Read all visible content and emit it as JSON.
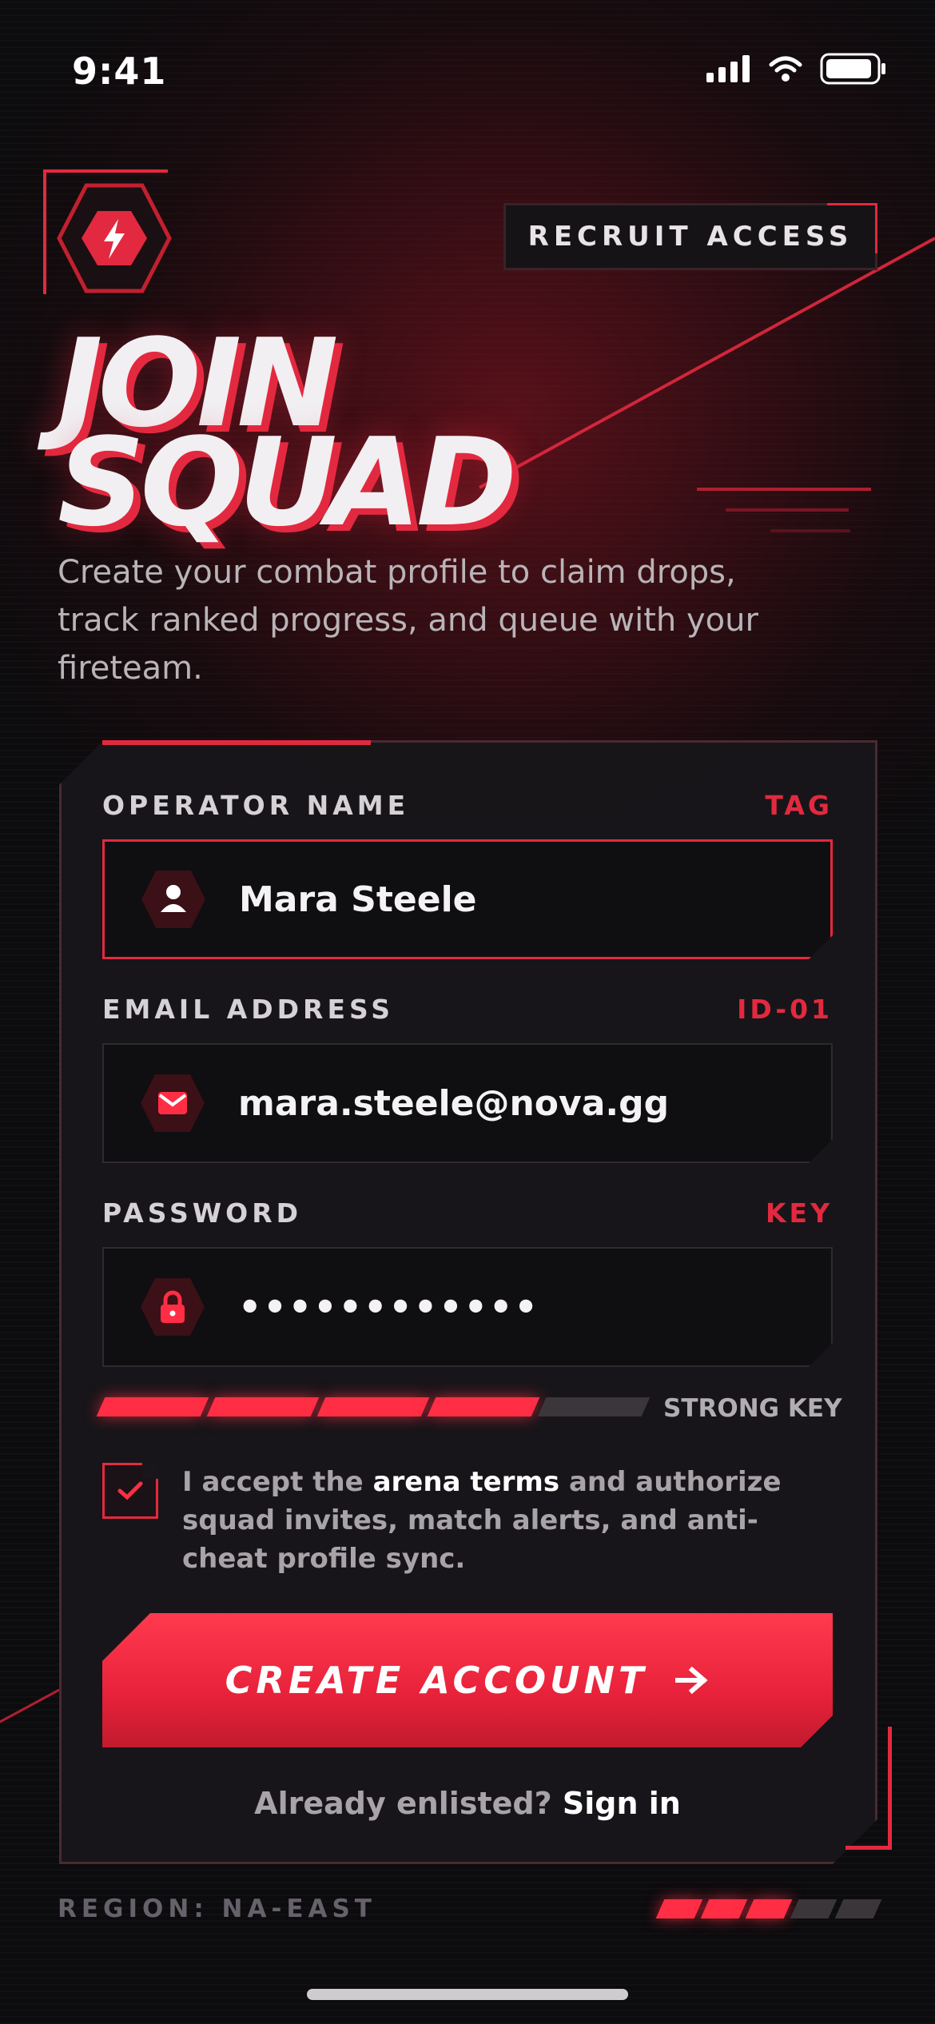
{
  "status_bar": {
    "time": "9:41",
    "icons": [
      "cellular-signal-icon",
      "wifi-icon",
      "battery-icon"
    ]
  },
  "header": {
    "logo_icon": "lightning-bolt-icon",
    "chip_label": "RECRUIT ACCESS",
    "title_line1": "JOIN",
    "title_line2": "SQUAD",
    "subtitle": "Create your combat profile to claim drops, track ranked progress, and queue with your fireteam."
  },
  "form": {
    "operator_name": {
      "label": "OPERATOR NAME",
      "tag": "TAG",
      "value": "Mara Steele",
      "icon": "user-icon"
    },
    "email": {
      "label": "EMAIL ADDRESS",
      "tag": "ID-01",
      "value": "mara.steele@nova.gg",
      "icon": "mail-icon"
    },
    "password": {
      "label": "PASSWORD",
      "tag": "KEY",
      "value": "••••••••••••",
      "icon": "lock-icon"
    },
    "strength": {
      "label": "STRONG KEY",
      "level": 4,
      "max": 5
    },
    "terms": {
      "checked": true,
      "prefix": "I accept the ",
      "link": "arena terms",
      "suffix": " and authorize squad invites, match alerts, and anti-cheat profile sync."
    },
    "cta": {
      "label": "CREATE ACCOUNT",
      "icon": "arrow-right-icon"
    },
    "signin": {
      "prompt": "Already enlisted? ",
      "link": "Sign in"
    }
  },
  "footer": {
    "region": "REGION: NA-EAST",
    "indicator_level": 3,
    "indicator_max": 5
  },
  "colors": {
    "accent": "#e3293f",
    "background": "#0c0b0d",
    "card": "#18161a"
  }
}
